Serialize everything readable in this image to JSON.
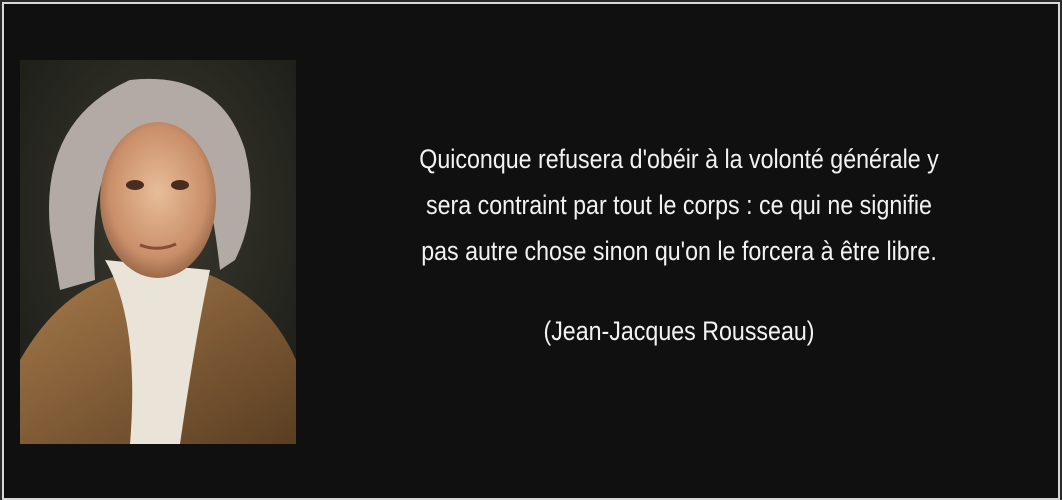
{
  "quote": {
    "lines": [
      "Quiconque refusera d'obéir à la volonté générale y",
      "sera contraint par tout le corps : ce qui ne signifie",
      "pas autre chose sinon qu'on le forcera à être libre."
    ],
    "author": "(Jean-Jacques Rousseau)"
  }
}
